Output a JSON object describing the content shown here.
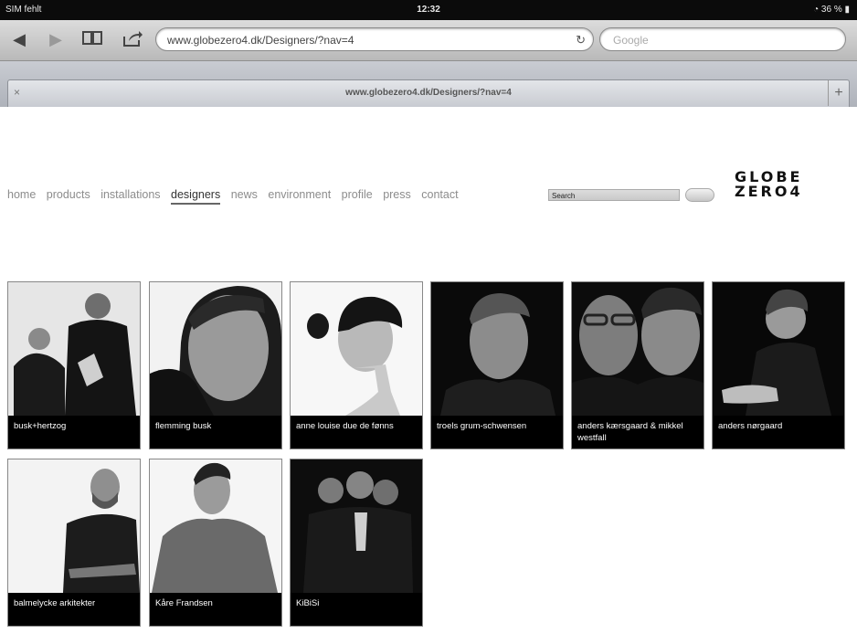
{
  "status_bar": {
    "carrier": "SIM fehlt",
    "time": "12:32",
    "battery": "36 %"
  },
  "browser": {
    "url": "www.globezero4.dk/Designers/?nav=4",
    "search_placeholder": "Google",
    "tab_title": "www.globezero4.dk/Designers/?nav=4",
    "icons": [
      "back-icon",
      "forward-icon",
      "bookmarks-icon",
      "share-icon",
      "reload-icon",
      "new-tab-icon"
    ]
  },
  "site": {
    "nav": [
      "home",
      "products",
      "installations",
      "designers",
      "news",
      "environment",
      "profile",
      "press",
      "contact"
    ],
    "active_nav": "designers",
    "search_value": "Search",
    "logo_line1": "GLOBE",
    "logo_line2": "ZERO4"
  },
  "designers": [
    {
      "name": "busk+hertzog",
      "bg": "light"
    },
    {
      "name": "flemming busk",
      "bg": "light"
    },
    {
      "name": "anne louise due de fønns",
      "bg": "light"
    },
    {
      "name": "troels grum-schwensen",
      "bg": "dark"
    },
    {
      "name": "anders kærsgaard & mikkel westfall",
      "bg": "dark"
    },
    {
      "name": "anders nørgaard",
      "bg": "dark"
    },
    {
      "name": "balmelycke arkitekter",
      "bg": "light"
    },
    {
      "name": "Kåre Frandsen",
      "bg": "light"
    },
    {
      "name": "KiBiSi",
      "bg": "dark"
    }
  ]
}
